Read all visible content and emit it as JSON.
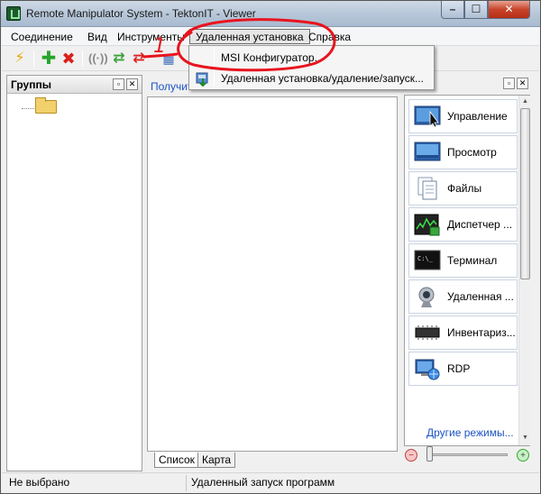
{
  "window": {
    "title": "Remote Manipulator System - TektonIT - Viewer",
    "controls": {
      "minimize": "–",
      "maximize": "☐",
      "close": "✕"
    }
  },
  "menubar": {
    "items": [
      "Соединение",
      "Вид",
      "Инструменты",
      "Удаленная установка",
      "Справка"
    ]
  },
  "dropdown": {
    "items": [
      "MSI Конфигуратор...",
      "Удаленная установка/удаление/запуск..."
    ]
  },
  "groups_pane": {
    "title": "Группы",
    "pin": "📌",
    "close": "✕"
  },
  "center_pane": {
    "tab_label": "Получить",
    "bottom_tabs": [
      "Список",
      "Карта"
    ]
  },
  "modes_pane": {
    "pin": "📌",
    "close": "✕",
    "items": [
      "Управление",
      "Просмотр",
      "Файлы",
      "Диспетчер ...",
      "Терминал",
      "Удаленная ...",
      "Инвентариз...",
      "RDP"
    ],
    "other_modes": "Другие режимы..."
  },
  "statusbar": {
    "left": "Не выбрано",
    "right": "Удаленный запуск программ"
  },
  "annotation": {
    "number": "1",
    "color": "#e8141e"
  },
  "colors": {
    "link": "#1b53c4",
    "close_button": "#c8442a"
  }
}
